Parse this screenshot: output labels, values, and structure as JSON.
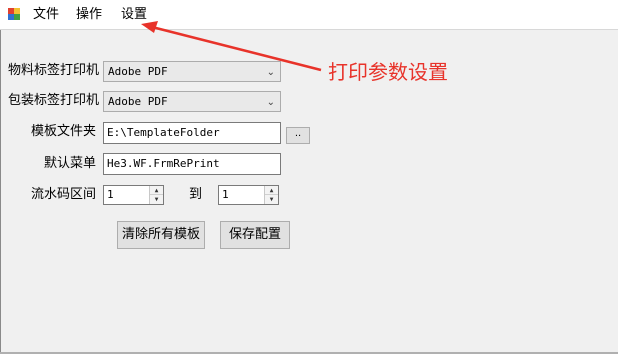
{
  "menu": {
    "file": "文件",
    "operations": "操作",
    "settings": "设置"
  },
  "form": {
    "material_printer_label": "物料标签打印机",
    "material_printer_value": "Adobe PDF",
    "package_printer_label": "包装标签打印机",
    "package_printer_value": "Adobe PDF",
    "template_folder_label": "模板文件夹",
    "template_folder_value": "E:\\TemplateFolder",
    "browse_label": "..",
    "default_menu_label": "默认菜单",
    "default_menu_value": "He3.WF.FrmRePrint",
    "serial_range_label": "流水码区间",
    "serial_from_value": "1",
    "serial_to_label": "到",
    "serial_to_value": "1",
    "clear_templates_button": "清除所有模板",
    "save_config_button": "保存配置"
  },
  "annotation": {
    "text": "打印参数设置",
    "color": "#e8332a"
  },
  "icons": {
    "app": "app-icon",
    "dropdown": "chevron-down-icon",
    "spin_up": "spin-up-icon",
    "spin_down": "spin-down-icon"
  }
}
